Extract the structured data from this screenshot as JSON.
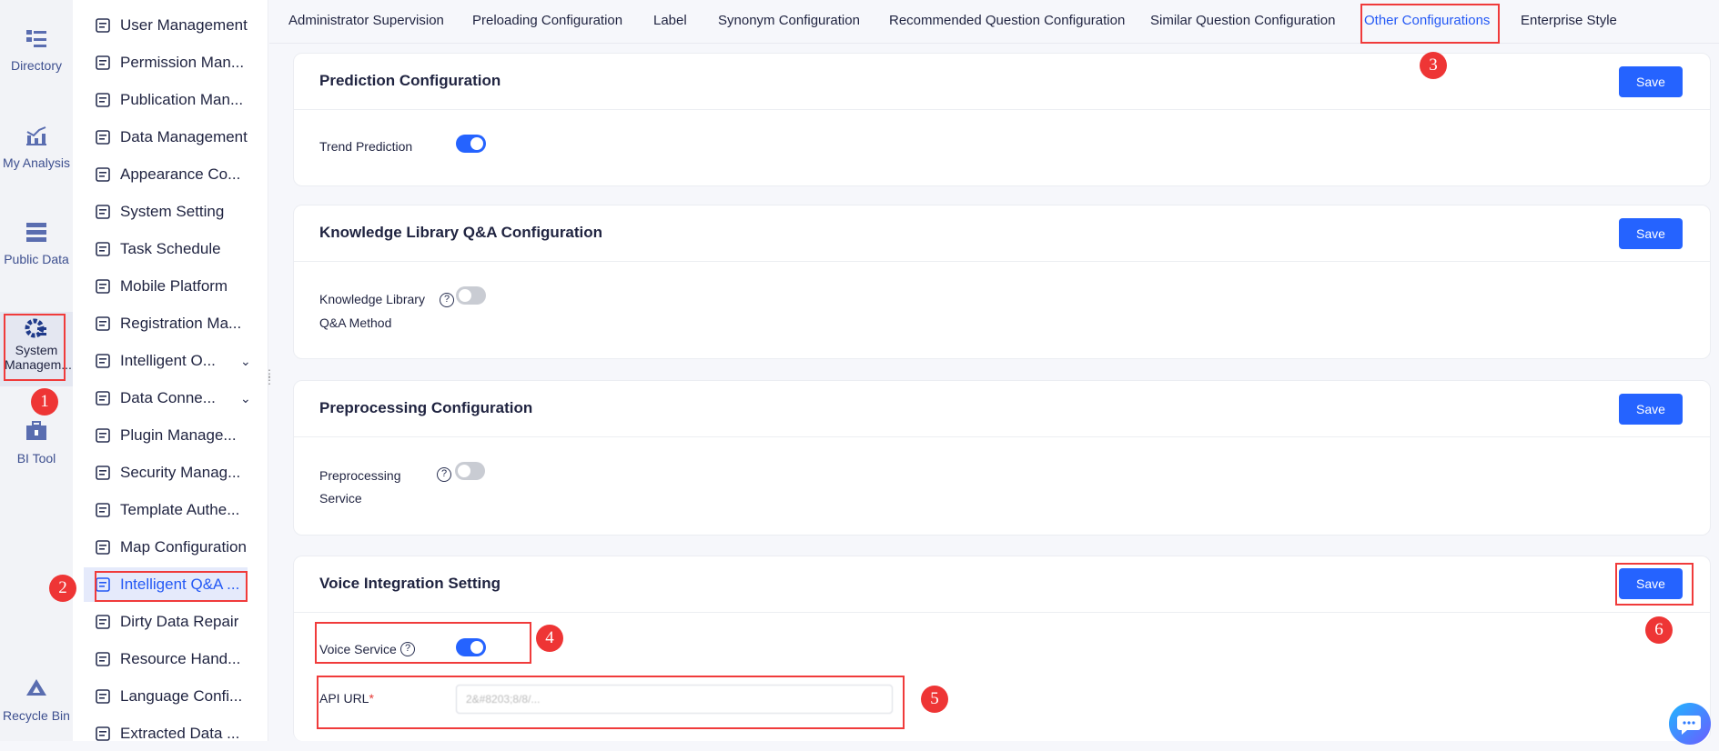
{
  "rail": [
    {
      "label": "Directory",
      "icon": "directory-icon"
    },
    {
      "label": "My Analysis",
      "icon": "chart-icon"
    },
    {
      "label": "Public Data",
      "icon": "database-icon"
    },
    {
      "label": "System Managem...",
      "icon": "gear-icon"
    },
    {
      "label": "BI Tool",
      "icon": "toolbox-icon"
    },
    {
      "label": "Recycle Bin",
      "icon": "recycle-icon"
    }
  ],
  "menu": [
    "User Management",
    "Permission Man...",
    "Publication Man...",
    "Data Management",
    "Appearance Co...",
    "System Setting",
    "Task Schedule",
    "Mobile Platform",
    "Registration Ma...",
    "Intelligent O...",
    "Data Conne...",
    "Plugin Manage...",
    "Security Manag...",
    "Template Authe...",
    "Map Configuration",
    "Intelligent Q&A ...",
    "Dirty Data Repair",
    "Resource Hand...",
    "Language Confi...",
    "Extracted Data ..."
  ],
  "tabs": [
    "Administrator Supervision",
    "Preloading Configuration",
    "Label",
    "Synonym Configuration",
    "Recommended Question Configuration",
    "Similar Question Configuration",
    "Other Configurations",
    "Enterprise Style"
  ],
  "cards": {
    "prediction": {
      "title": "Prediction Configuration",
      "save": "Save",
      "label": "Trend Prediction",
      "enabled": true
    },
    "knowledge": {
      "title": "Knowledge Library Q&A Configuration",
      "save": "Save",
      "label1": "Knowledge Library",
      "label2": "Q&A Method",
      "help": "?",
      "enabled": false
    },
    "preprocessing": {
      "title": "Preprocessing Configuration",
      "save": "Save",
      "label1": "Preprocessing",
      "label2": "Service",
      "help": "?",
      "enabled": false
    },
    "voice": {
      "title": "Voice Integration Setting",
      "save": "Save",
      "label": "Voice Service",
      "help": "?",
      "enabled": true,
      "api_label": "API URL",
      "required": "*",
      "api_value": "2&#8203;8/8/..."
    }
  },
  "annotations": [
    "1",
    "2",
    "3",
    "4",
    "5",
    "6"
  ],
  "colors": {
    "primary": "#2563ff",
    "annotation": "#f03b3b"
  }
}
